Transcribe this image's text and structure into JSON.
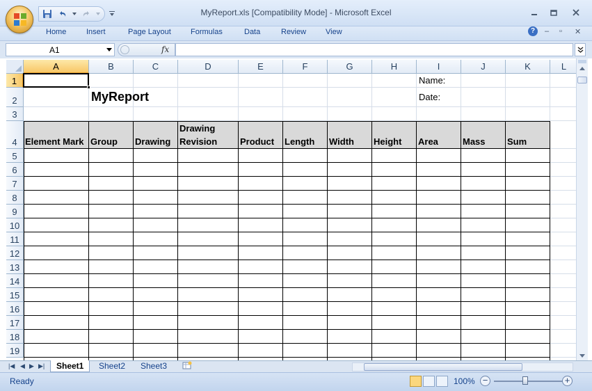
{
  "window": {
    "title": "MyReport.xls  [Compatibility Mode] - Microsoft Excel",
    "minimize_icon": "minimize-icon",
    "maximize_icon": "maximize-icon",
    "close_icon": "close-icon"
  },
  "ribbon_tabs": [
    "Home",
    "Insert",
    "Page Layout",
    "Formulas",
    "Data",
    "Review",
    "View"
  ],
  "formula_bar": {
    "name_box": "A1",
    "fx_label": "fx",
    "formula": ""
  },
  "columns": [
    "A",
    "B",
    "C",
    "D",
    "E",
    "F",
    "G",
    "H",
    "I",
    "J",
    "K",
    "L"
  ],
  "rows": [
    "1",
    "2",
    "3",
    "4",
    "5",
    "6",
    "7",
    "8",
    "9",
    "10",
    "11",
    "12",
    "13",
    "14",
    "15",
    "16",
    "17",
    "18",
    "19"
  ],
  "sheet": {
    "title": "MyReport",
    "name_label": "Name:",
    "date_label": "Date:",
    "headers": [
      "Element Mark",
      "Group",
      "Drawing",
      "Drawing Revision",
      "Product",
      "Length",
      "Width",
      "Height",
      "Area",
      "Mass",
      "Sum"
    ]
  },
  "sheet_tabs": [
    "Sheet1",
    "Sheet2",
    "Sheet3"
  ],
  "active_sheet": "Sheet1",
  "status": {
    "text": "Ready",
    "zoom": "100%",
    "zoom_level": 1.0
  },
  "colors": {
    "selection_header": "#f8c767",
    "table_header_fill": "#d9d9d9",
    "grid_line": "#d5dde8"
  }
}
